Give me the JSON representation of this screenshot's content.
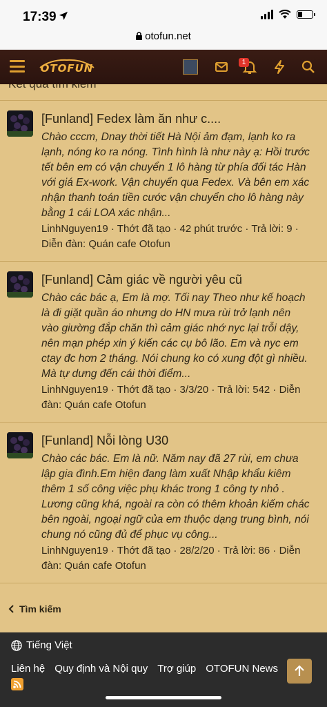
{
  "status": {
    "time": "17:39"
  },
  "browser": {
    "url": "otofun.net"
  },
  "header": {
    "logo": "OTOFUN",
    "alert_count": "1"
  },
  "page": {
    "title": "Kết quả tìm kiếm"
  },
  "results": [
    {
      "title": "[Funland] Fedex làm ăn như c....",
      "snippet_lines": [
        "Chào cccm, Dnay thời tiết Hà Nội ảm đạm, lạnh ko ra",
        "lạnh, nóng ko ra nóng. Tình hình là như này ạ: Hồi trước",
        "tết bên em có vận chuyển 1 lô hàng từ phía đối tác Hàn",
        "với giá Ex-work. Vận chuyển qua Fedex. Và bên em xác",
        "nhận thanh toán tiền cước vận chuyển cho lô hàng này",
        "bằng 1 cái LOA xác nhận..."
      ],
      "meta_lines": [
        "LinhNguyen19 · Thớt đã tạo · 42 phút trước · Trả lời: 9 ·",
        "Diễn đàn: Quán cafe Otofun"
      ]
    },
    {
      "title": "[Funland] Cảm giác về người yêu cũ",
      "snippet_lines": [
        "Chào các bác ạ, Em là mợ. Tối nay Theo như kế hoạch",
        "là đi giặt quần áo nhưng do HN mưa rùi trở lạnh nên",
        "vào giường đắp chăn thì cảm giác nhớ nyc lại trỗi dậy,",
        "nên mạn phép xin ý kiến các cụ bô lão. Em và nyc em",
        "ctay đc hơn 2 tháng. Nói chung ko có xung đột gì nhiều.",
        "Mà tự dưng đến cái thời điểm..."
      ],
      "meta_lines": [
        "LinhNguyen19 · Thớt đã tạo · 3/3/20 · Trả lời: 542 · Diễn",
        "đàn: Quán cafe Otofun"
      ]
    },
    {
      "title": "[Funland] Nỗi lòng U30",
      "snippet_lines": [
        "Chào các bác. Em là nữ. Năm nay đã 27 rùi, em chưa",
        "lập gia đình.Em hiện đang làm xuất Nhập khẩu kiêm",
        "thêm 1 số công việc phụ khác trong 1 công ty nhỏ .",
        "Lương cũng khá, ngoài ra còn có thêm khoản kiếm chác",
        "bên ngoài, ngoại ngữ của em thuộc dạng trung bình, nói",
        "chung nó cũng đủ để phục vụ công..."
      ],
      "meta_lines": [
        "LinhNguyen19 · Thớt đã tạo · 28/2/20 · Trả lời: 86 · Diễn",
        "đàn: Quán cafe Otofun"
      ]
    }
  ],
  "back_link": "Tìm kiếm",
  "footer": {
    "language": "Tiếng Việt",
    "links": [
      "Liên hệ",
      "Quy định và Nội quy",
      "Trợ giúp",
      "OTOFUN News"
    ]
  }
}
